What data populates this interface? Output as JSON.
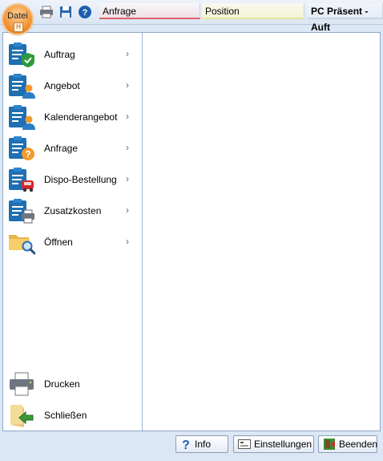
{
  "ribbon": {
    "file_button": "Datei",
    "file_hotkey": "H",
    "tabs": [
      {
        "label": "Anfrage"
      },
      {
        "label": "Position"
      },
      {
        "label": "PC Präsent - Auft"
      }
    ]
  },
  "menu": {
    "items": [
      {
        "label": "Auftrag",
        "icon": "clipboard-check-icon"
      },
      {
        "label": "Angebot",
        "icon": "clipboard-person-icon"
      },
      {
        "label": "Kalenderangebot",
        "icon": "clipboard-person-icon"
      },
      {
        "label": "Anfrage",
        "icon": "clipboard-question-icon"
      },
      {
        "label": "Dispo-Bestellung",
        "icon": "clipboard-truck-icon"
      },
      {
        "label": "Zusatzkosten",
        "icon": "clipboard-printer-icon"
      },
      {
        "label": "Öffnen",
        "icon": "folder-search-icon"
      }
    ],
    "bottom": [
      {
        "label": "Drucken",
        "icon": "printer-icon"
      },
      {
        "label": "Schließen",
        "icon": "close-folder-icon"
      }
    ],
    "arrow": "›"
  },
  "footer": {
    "info": "Info",
    "settings": "Einstellungen",
    "quit": "Beenden"
  },
  "colors": {
    "accent": "#f08a24",
    "clipboard": "#1f6fb2",
    "background": "#dce7f5"
  }
}
